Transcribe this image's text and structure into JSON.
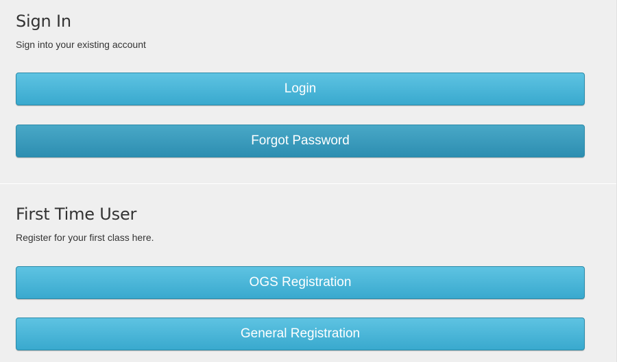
{
  "sign_in": {
    "title": "Sign In",
    "subtitle": "Sign into your existing account",
    "login_label": "Login",
    "forgot_label": "Forgot Password"
  },
  "first_time": {
    "title": "First Time User",
    "subtitle": "Register for your first class here.",
    "ogs_label": "OGS Registration",
    "general_label": "General Registration"
  },
  "colors": {
    "panel_background": "#efefef",
    "button_primary": "#4fb8da",
    "button_secondary": "#3b9dc0",
    "button_text": "#ffffff",
    "text": "#333333"
  }
}
